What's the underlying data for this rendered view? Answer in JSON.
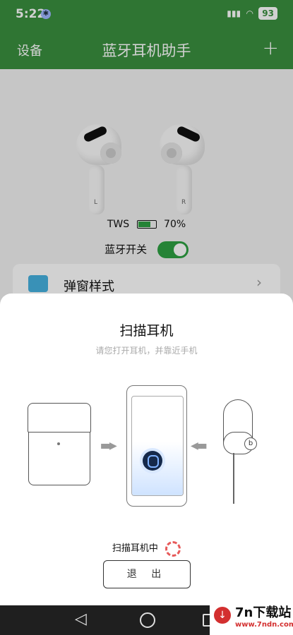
{
  "status": {
    "time": "5:22",
    "battery": "93"
  },
  "header": {
    "left_label": "设备",
    "title": "蓝牙耳机助手",
    "add": "+"
  },
  "main": {
    "earbuds": {
      "left_mark": "L",
      "right_mark": "R"
    },
    "tws_label": "TWS",
    "battery_percent_text": "70%",
    "battery_level": 0.7,
    "bluetooth_label": "蓝牙开关",
    "bluetooth_on": true,
    "popup_style_label": "弹窗样式"
  },
  "sheet": {
    "title": "扫描耳机",
    "subtitle": "请您打开耳机，并靠近手机",
    "scanning_text": "扫描耳机中",
    "exit_label": "退 出"
  },
  "watermark": {
    "brand": "7n下载站",
    "url": "www.7ndn.com"
  },
  "colors": {
    "header": "#3a8f3f",
    "accent": "#2ea043",
    "spinner": "#e75a5a"
  },
  "icons": [
    "bluetooth-icon",
    "plus-icon",
    "chevron-right-icon",
    "back-icon",
    "home-icon",
    "recent-apps-icon",
    "download-icon"
  ]
}
